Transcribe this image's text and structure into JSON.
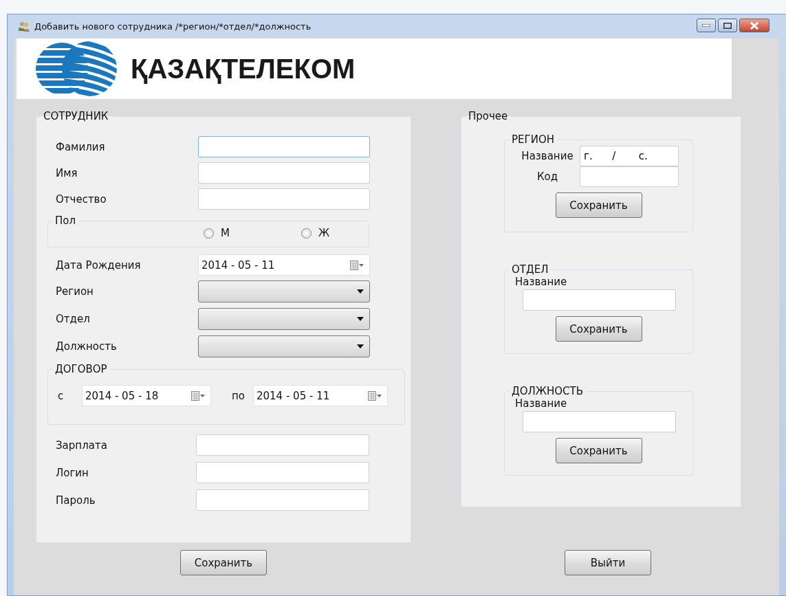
{
  "window": {
    "title": "Добавить нового сотрудника /*регион/*отдел/*должность"
  },
  "banner": {
    "company": "ҚАЗАҚТЕЛЕКОМ"
  },
  "employee": {
    "title": "СОТРУДНИК",
    "name_fields": [
      {
        "label": "Фамилия",
        "focused": true
      },
      {
        "label": "Имя",
        "focused": false
      },
      {
        "label": "Отчество",
        "focused": false
      }
    ],
    "gender": {
      "title": "Пол",
      "options": [
        {
          "label": "М",
          "selected": false
        },
        {
          "label": "Ж",
          "selected": false
        }
      ]
    },
    "birth_date": {
      "label": "Дата Рождения",
      "value": "2014 - 05 - 11"
    },
    "selects": [
      {
        "label": "Регион"
      },
      {
        "label": "Отдел"
      },
      {
        "label": "Должность"
      }
    ],
    "contract": {
      "title": "ДОГОВОР",
      "from": {
        "label": "с",
        "value": "2014 - 05 - 18"
      },
      "to": {
        "label": "по",
        "value": "2014 - 05 - 11"
      }
    },
    "account_fields": [
      {
        "label": "Зарплата"
      },
      {
        "label": "Логин"
      },
      {
        "label": "Пароль"
      }
    ]
  },
  "other": {
    "title": "Прочее",
    "region": {
      "title": "РЕГИОН",
      "fields": [
        {
          "label": "Название",
          "value": "г.      /       с."
        },
        {
          "label": "Код"
        }
      ],
      "button": "Сохранить"
    },
    "department": {
      "title": "ОТДЕЛ",
      "field_label": "Название",
      "button": "Сохранить"
    },
    "position": {
      "title": "ДОЛЖНОСТЬ",
      "field_label": "Название",
      "button": "Сохранить"
    }
  },
  "footer": {
    "save": "Сохранить",
    "exit": "Выйти"
  }
}
